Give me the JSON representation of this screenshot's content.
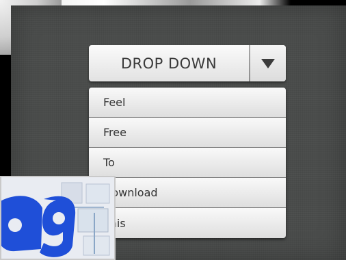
{
  "dropdown": {
    "label": "DROP DOWN",
    "arrow_icon": "triangle-down-icon"
  },
  "menu": {
    "items": [
      {
        "label": "Feel"
      },
      {
        "label": "Free"
      },
      {
        "label": "To"
      },
      {
        "label": "Download"
      },
      {
        "label": "This"
      }
    ]
  },
  "colors": {
    "panel_background": "#4a4c4b",
    "button_text": "#3a3a3a",
    "menu_text": "#333333",
    "logo_blue": "#1f4fd8"
  }
}
